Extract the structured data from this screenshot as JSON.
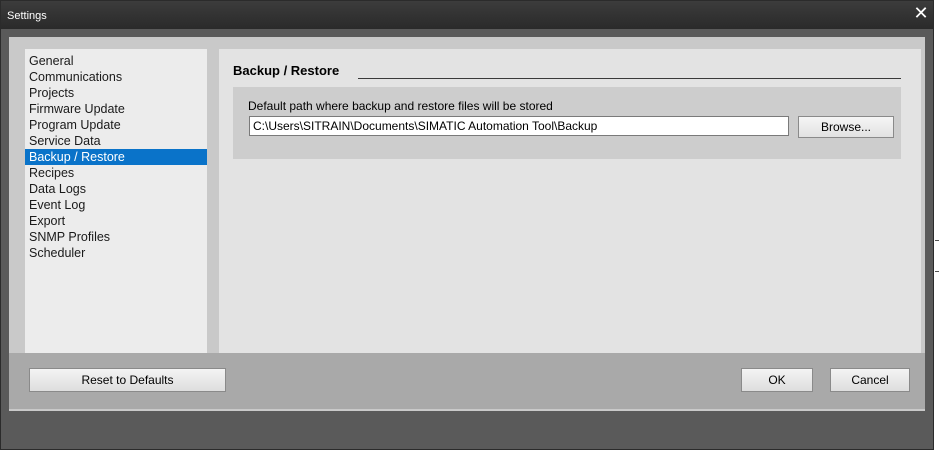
{
  "window": {
    "title": "Settings",
    "close_glyph": "✕"
  },
  "sidebar": {
    "items": [
      {
        "label": "General",
        "selected": false
      },
      {
        "label": "Communications",
        "selected": false
      },
      {
        "label": "Projects",
        "selected": false
      },
      {
        "label": "Firmware Update",
        "selected": false
      },
      {
        "label": "Program Update",
        "selected": false
      },
      {
        "label": "Service Data",
        "selected": false
      },
      {
        "label": "Backup / Restore",
        "selected": true
      },
      {
        "label": "Recipes",
        "selected": false
      },
      {
        "label": "Data Logs",
        "selected": false
      },
      {
        "label": "Event Log",
        "selected": false
      },
      {
        "label": "Export",
        "selected": false
      },
      {
        "label": "SNMP Profiles",
        "selected": false
      },
      {
        "label": "Scheduler",
        "selected": false
      }
    ]
  },
  "content": {
    "section_title": "Backup / Restore",
    "path_label": "Default path where backup and restore files will be stored",
    "path_value": "C:\\Users\\SITRAIN\\Documents\\SIMATIC Automation Tool\\Backup",
    "browse_label": "Browse..."
  },
  "footer": {
    "reset_label": "Reset to Defaults",
    "ok_label": "OK",
    "cancel_label": "Cancel"
  },
  "colors": {
    "selection": "#0a73c9",
    "titlebar": "#2a2a2a"
  }
}
